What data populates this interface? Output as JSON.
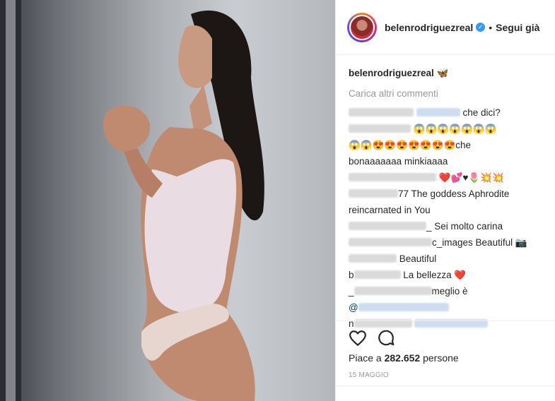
{
  "post": {
    "username": "belenrodriguezreal",
    "verified_icon": "verified-badge-icon",
    "separator": "•",
    "follow_label": "Segui già",
    "caption_user": "belenrodriguezreal",
    "caption_text": "🦋",
    "load_more": "Carica altri commenti",
    "likes_prefix": "Piace a ",
    "likes_count": "282.652",
    "likes_suffix": " persone",
    "date": "15 MAGGIO"
  },
  "comments": [
    {
      "text": "che dici?"
    },
    {
      "text": "😱😱😱😱😱😱😱"
    },
    {
      "text": "😱😱😍😍😍😍😍😍😍che"
    },
    {
      "text": "bonaaaaaaa minkiaaaa"
    },
    {
      "text": "❤️💕♥🌷💥💥"
    },
    {
      "name_suffix": "77",
      "text": "The goddess Aphrodite"
    },
    {
      "text": "reincarnated in You"
    },
    {
      "name_suffix": "_",
      "text": "Sei molto carina"
    },
    {
      "name_suffix": "c_images",
      "text": "Beautiful 📷"
    },
    {
      "text": "Beautiful"
    },
    {
      "name_prefix": "b",
      "text": "La bellezza ❤️"
    },
    {
      "name_prefix": "_",
      "text": "meglio è"
    },
    {
      "text": "@"
    },
    {
      "name_prefix": "n",
      "text": ""
    }
  ],
  "icons": {
    "like": "heart-outline-icon",
    "comment": "comment-bubble-icon"
  }
}
